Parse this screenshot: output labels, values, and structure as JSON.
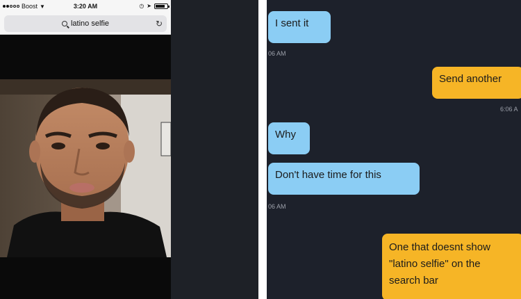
{
  "left_phone": {
    "status_bar": {
      "carrier": "Boost",
      "time": "3:20 AM"
    },
    "address_bar": {
      "query": "latino selfie"
    },
    "image": {
      "subject": "selfie photo of a man"
    }
  },
  "chat": {
    "messages": [
      {
        "sender": "them",
        "text": "I sent it"
      },
      {
        "sender": "meta",
        "text": "06 AM"
      },
      {
        "sender": "me",
        "text": "Send another"
      },
      {
        "sender": "meta",
        "text": "6:06 A"
      },
      {
        "sender": "them",
        "text": "Why"
      },
      {
        "sender": "them",
        "text": "Don't have time for this"
      },
      {
        "sender": "meta",
        "text": "06 AM"
      },
      {
        "sender": "me",
        "lines": [
          "One that doesnt show",
          "\"latino selfie\" on the",
          "search bar"
        ]
      }
    ]
  },
  "colors": {
    "them_bubble": "#8bcdf4",
    "me_bubble": "#f6b526",
    "chat_background": "#1d212b"
  }
}
